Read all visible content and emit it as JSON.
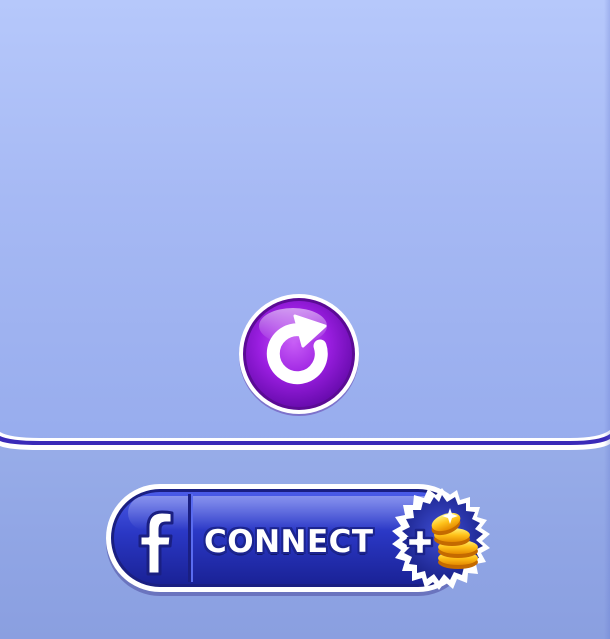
{
  "screen": {
    "background_top": "#b6c8fb",
    "background_bottom": "#8a9fe0",
    "divider_color": "#3a2ab8"
  },
  "replay_button": {
    "icon": "replay-icon",
    "color": "#9a1ee0"
  },
  "connect_button": {
    "label": "CONNECT",
    "social_icon": "facebook-icon",
    "reward_icon": "plus-coins-icon",
    "color": "#2a37c4"
  }
}
